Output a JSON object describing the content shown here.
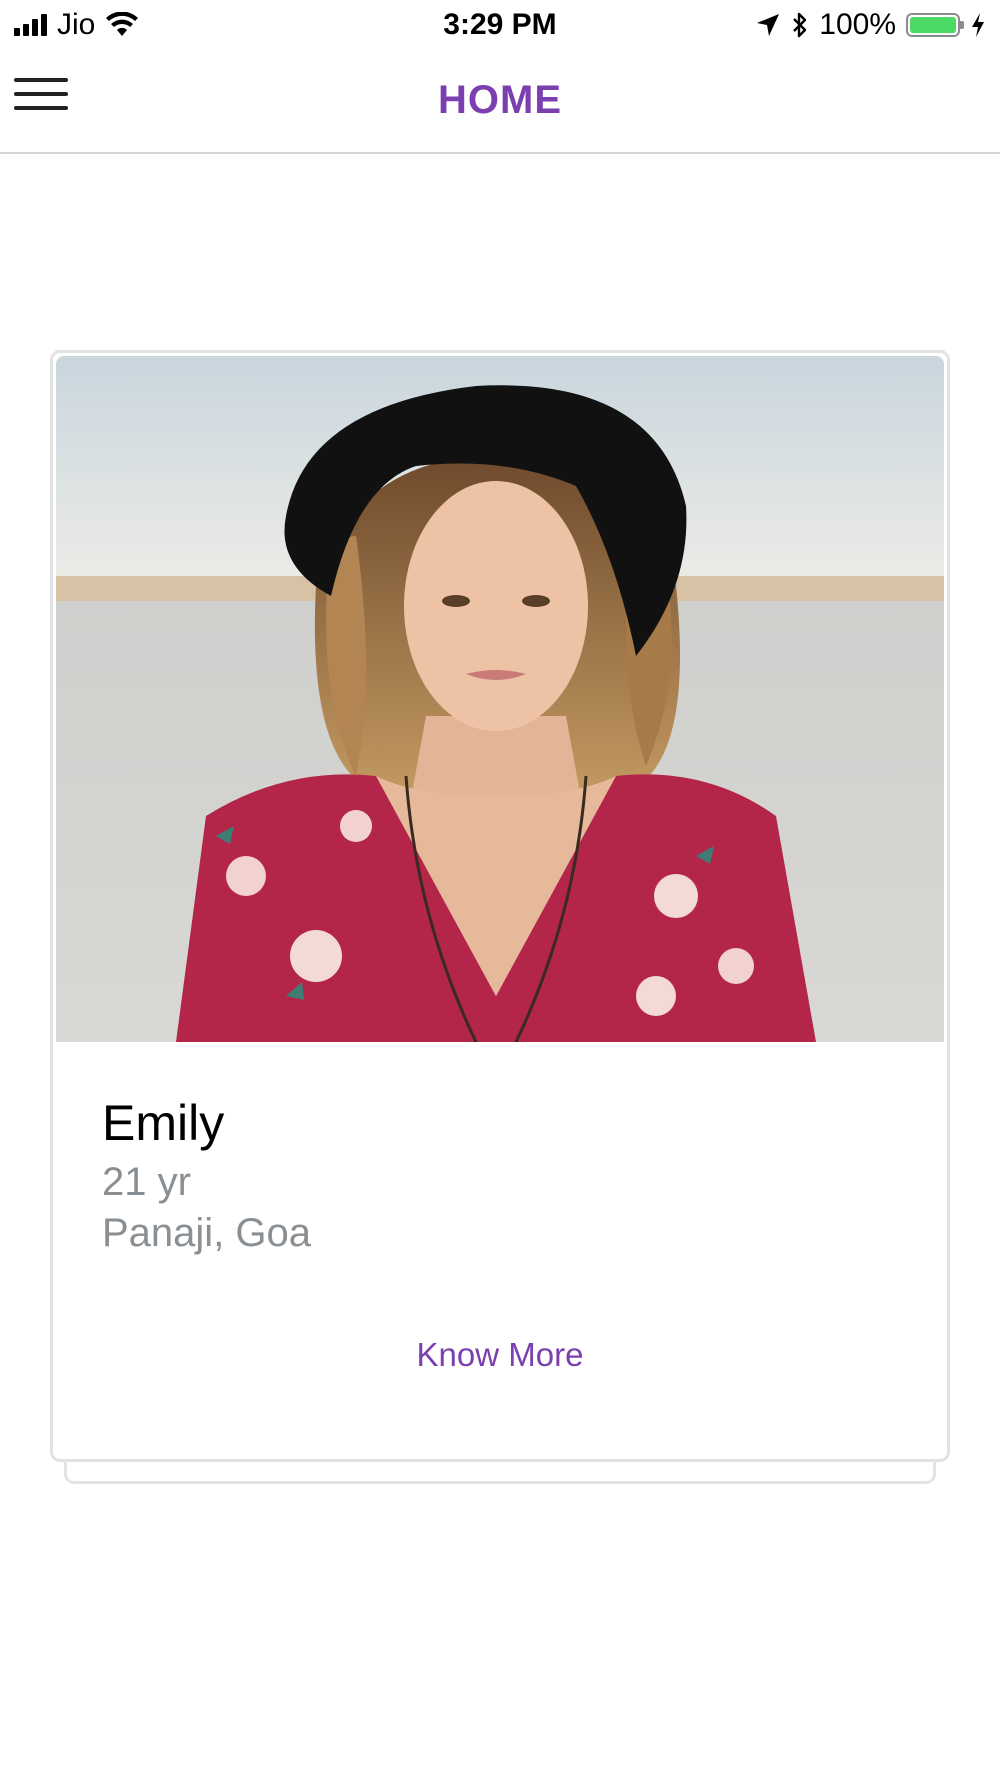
{
  "status_bar": {
    "carrier": "Jio",
    "time": "3:29 PM",
    "battery_percent": "100%",
    "battery_level": 1.0,
    "icons": [
      "signal-icon",
      "wifi-icon",
      "location-arrow-icon",
      "bluetooth-icon",
      "battery-icon",
      "charging-icon"
    ]
  },
  "header": {
    "title": "HOME",
    "menu_icon": "hamburger-menu-icon"
  },
  "card": {
    "name": "Emily",
    "age": "21 yr",
    "location": "Panaji, Goa",
    "action_label": "Know More"
  },
  "colors": {
    "accent": "#7b3fb0",
    "secondary_text": "#8a8f93",
    "battery_green": "#4cd964",
    "border": "#e2e2e2"
  }
}
